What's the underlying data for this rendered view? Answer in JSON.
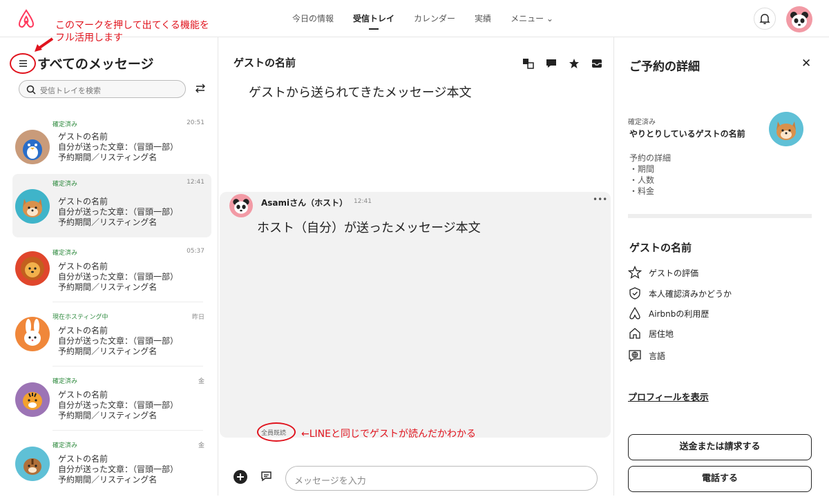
{
  "nav": {
    "items": [
      "今日の情報",
      "受信トレイ",
      "カレンダー",
      "実績",
      "メニュー"
    ]
  },
  "annotations": {
    "menu_note_line1": "このマークを押して出てくる機能を",
    "menu_note_line2": "フル活用します",
    "read_note": "←LINEと同じでゲストが読んだかわかる"
  },
  "inbox": {
    "title": "すべてのメッセージ",
    "search_placeholder": "受信トレイを検索",
    "conversations": [
      {
        "status": "確定済み",
        "time": "20:51",
        "name": "ゲストの名前",
        "preview": "自分が送った文章：（冒頭一部）",
        "listing": "予約期間／リスティング名"
      },
      {
        "status": "確定済み",
        "time": "12:41",
        "name": "ゲストの名前",
        "preview": "自分が送った文章：（冒頭一部）",
        "listing": "予約期間／リスティング名"
      },
      {
        "status": "確定済み",
        "time": "05:37",
        "name": "ゲストの名前",
        "preview": "自分が送った文章：（冒頭一部）",
        "listing": "予約期間／リスティング名"
      },
      {
        "status": "現在ホスティング中",
        "time": "昨日",
        "name": "ゲストの名前",
        "preview": "自分が送った文章：（冒頭一部）",
        "listing": "予約期間／リスティング名"
      },
      {
        "status": "確定済み",
        "time": "金",
        "name": "ゲストの名前",
        "preview": "自分が送った文章：（冒頭一部）",
        "listing": "予約期間／リスティング名"
      },
      {
        "status": "確定済み",
        "time": "金",
        "name": "ゲストの名前",
        "preview": "自分が送った文章：（冒頭一部）",
        "listing": "予約期間／リスティング名"
      }
    ]
  },
  "thread": {
    "title": "ゲストの名前",
    "guest_message": "ゲストから送られてきたメッセージ本文",
    "host_name": "Asamiさん（ホスト）",
    "host_time": "12:41",
    "host_message": "ホスト（自分）が送ったメッセージ本文",
    "read_label": "全員既読",
    "compose_placeholder": "メッセージを入力"
  },
  "details": {
    "title": "ご予約の詳細",
    "status": "確定済み",
    "guest_name": "やりとりしているゲストの名前",
    "reservation_lines": [
      "予約の詳細",
      "・期間",
      "・人数",
      "・料金"
    ],
    "guest_section_title": "ゲストの名前",
    "guest_items": [
      "ゲストの評価",
      "本人確認済みかどうか",
      "Airbnbの利用歴",
      "居住地",
      "言語"
    ],
    "profile_link": "プロフィールを表示",
    "buttons": [
      "送金または請求する",
      "電話する"
    ]
  },
  "colors": {
    "brand": "#ff385c",
    "annotation": "#e0141e",
    "status_green": "#2e8a3e"
  }
}
